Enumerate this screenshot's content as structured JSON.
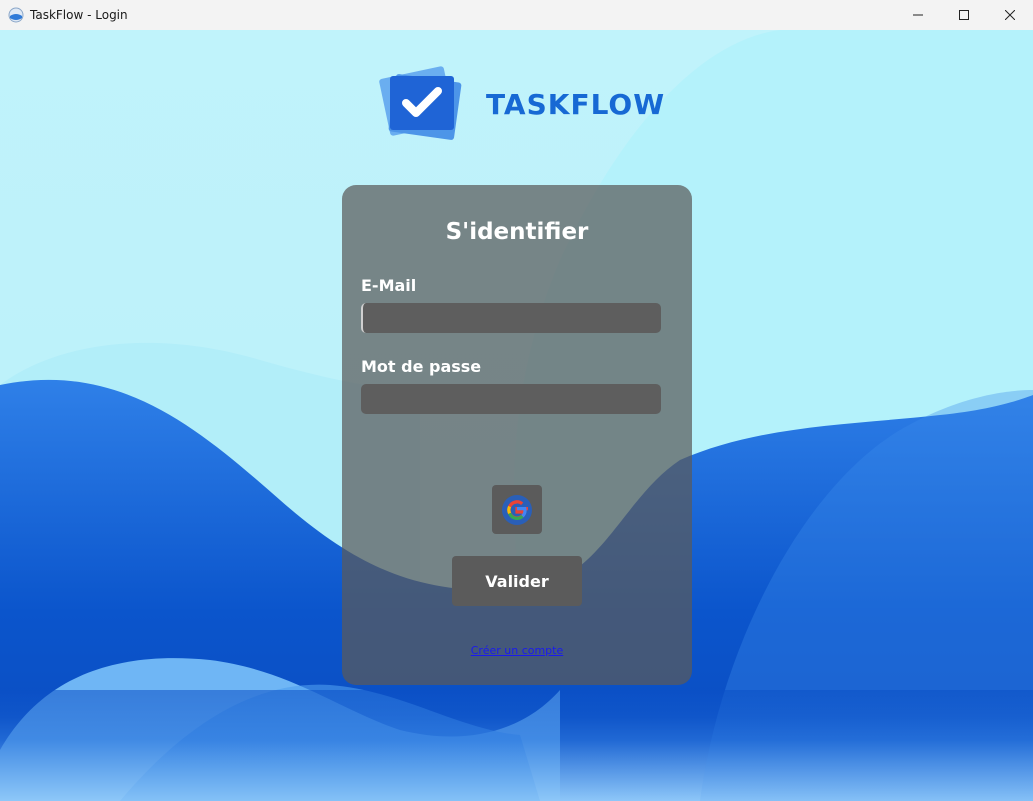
{
  "window": {
    "title": "TaskFlow - Login"
  },
  "logo": {
    "text": "TASKFLOW"
  },
  "form": {
    "title": "S'identifier",
    "email_label": "E-Mail",
    "email_value": "",
    "password_label": "Mot de passe",
    "password_value": "",
    "google_icon": "google-icon",
    "submit_label": "Valider",
    "create_account_link": "Créer un compte"
  },
  "colors": {
    "accent": "#1769d4",
    "card": "#5a5a5a",
    "link": "#1a1aee",
    "background_light": "#bff3fb",
    "wave_dark": "#0a52c9"
  }
}
